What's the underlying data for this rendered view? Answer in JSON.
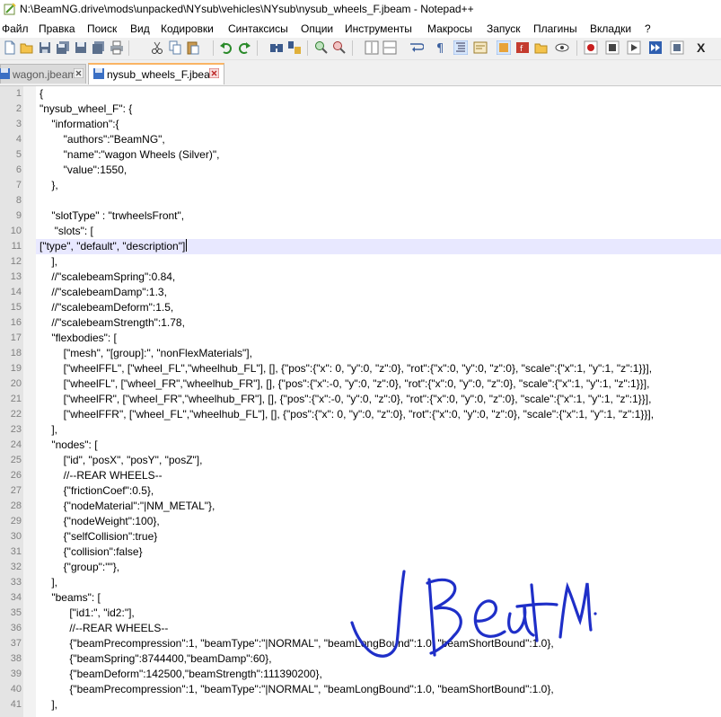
{
  "window": {
    "title": "N:\\BeamNG.drive\\mods\\unpacked\\NYsub\\vehicles\\NYsub\\nysub_wheels_F.jbeam - Notepad++"
  },
  "menu": [
    "Файл",
    "Правка",
    "Поиск",
    "Вид",
    "Кодировки",
    "Синтаксисы",
    "Опции",
    "Инструменты",
    "Макросы",
    "Запуск",
    "Плагины",
    "Вкладки",
    "?"
  ],
  "toolbar_end_label": "X",
  "tabs": [
    {
      "label": "wagon.jbeam",
      "active": false
    },
    {
      "label": "nysub_wheels_F.jbeam",
      "active": true
    }
  ],
  "editor": {
    "current_line": 11,
    "lines": [
      {
        "n": "1",
        "text": "{"
      },
      {
        "n": "2",
        "text": "\"nysub_wheel_F\": {"
      },
      {
        "n": "3",
        "text": "    \"information\":{"
      },
      {
        "n": "4",
        "text": "        \"authors\":\"BeamNG\","
      },
      {
        "n": "5",
        "text": "        \"name\":\"wagon Wheels (Silver)\","
      },
      {
        "n": "6",
        "text": "        \"value\":1550,"
      },
      {
        "n": "7",
        "text": "    },"
      },
      {
        "n": "8",
        "text": ""
      },
      {
        "n": "9",
        "text": "    \"slotType\" : \"trwheelsFront\","
      },
      {
        "n": "10",
        "text": "     \"slots\": ["
      },
      {
        "n": "11",
        "text": "[\"type\", \"default\", \"description\"]"
      },
      {
        "n": "12",
        "text": "    ],"
      },
      {
        "n": "13",
        "text": "    //\"scalebeamSpring\":0.84,"
      },
      {
        "n": "14",
        "text": "    //\"scalebeamDamp\":1.3,"
      },
      {
        "n": "15",
        "text": "    //\"scalebeamDeform\":1.5,"
      },
      {
        "n": "16",
        "text": "    //\"scalebeamStrength\":1.78,"
      },
      {
        "n": "17",
        "text": "    \"flexbodies\": ["
      },
      {
        "n": "18",
        "text": "        [\"mesh\", \"[group]:\", \"nonFlexMaterials\"],"
      },
      {
        "n": "19",
        "text": "        [\"wheelFFL\", [\"wheel_FL\",\"wheelhub_FL\"], [], {\"pos\":{\"x\": 0, \"y\":0, \"z\":0}, \"rot\":{\"x\":0, \"y\":0, \"z\":0}, \"scale\":{\"x\":1, \"y\":1, \"z\":1}}],"
      },
      {
        "n": "20",
        "text": "        [\"wheelFL\", [\"wheel_FR\",\"wheelhub_FR\"], [], {\"pos\":{\"x\":-0, \"y\":0, \"z\":0}, \"rot\":{\"x\":0, \"y\":0, \"z\":0}, \"scale\":{\"x\":1, \"y\":1, \"z\":1}}],"
      },
      {
        "n": "21",
        "text": "        [\"wheelFR\", [\"wheel_FR\",\"wheelhub_FR\"], [], {\"pos\":{\"x\":-0, \"y\":0, \"z\":0}, \"rot\":{\"x\":0, \"y\":0, \"z\":0}, \"scale\":{\"x\":1, \"y\":1, \"z\":1}}],"
      },
      {
        "n": "22",
        "text": "        [\"wheelFFR\", [\"wheel_FL\",\"wheelhub_FL\"], [], {\"pos\":{\"x\": 0, \"y\":0, \"z\":0}, \"rot\":{\"x\":0, \"y\":0, \"z\":0}, \"scale\":{\"x\":1, \"y\":1, \"z\":1}}],"
      },
      {
        "n": "23",
        "text": "    ],"
      },
      {
        "n": "24",
        "text": "    \"nodes\": ["
      },
      {
        "n": "25",
        "text": "        [\"id\", \"posX\", \"posY\", \"posZ\"],"
      },
      {
        "n": "26",
        "text": "        //--REAR WHEELS--"
      },
      {
        "n": "27",
        "text": "        {\"frictionCoef\":0.5},"
      },
      {
        "n": "28",
        "text": "        {\"nodeMaterial\":\"|NM_METAL\"},"
      },
      {
        "n": "29",
        "text": "        {\"nodeWeight\":100},"
      },
      {
        "n": "30",
        "text": "        {\"selfCollision\":true}"
      },
      {
        "n": "31",
        "text": "        {\"collision\":false}"
      },
      {
        "n": "32",
        "text": "        {\"group\":\"\"},"
      },
      {
        "n": "33",
        "text": "    ],"
      },
      {
        "n": "34",
        "text": "    \"beams\": ["
      },
      {
        "n": "35",
        "text": "          [\"id1:\", \"id2:\"],"
      },
      {
        "n": "36",
        "text": "          //--REAR WHEELS--"
      },
      {
        "n": "37",
        "text": "          {\"beamPrecompression\":1, \"beamType\":\"|NORMAL\", \"beamLongBound\":1.0, \"beamShortBound\":1.0},"
      },
      {
        "n": "38",
        "text": "          {\"beamSpring\":8744400,\"beamDamp\":60},"
      },
      {
        "n": "39",
        "text": "          {\"beamDeform\":142500,\"beamStrength\":111390200},"
      },
      {
        "n": "40",
        "text": "          {\"beamPrecompression\":1, \"beamType\":\"|NORMAL\", \"beamLongBound\":1.0, \"beamShortBound\":1.0},"
      },
      {
        "n": "41",
        "text": "    ],"
      }
    ]
  },
  "annotation": {
    "handwritten_text": "JBeaM",
    "ink_color": "#1f2fc8"
  }
}
